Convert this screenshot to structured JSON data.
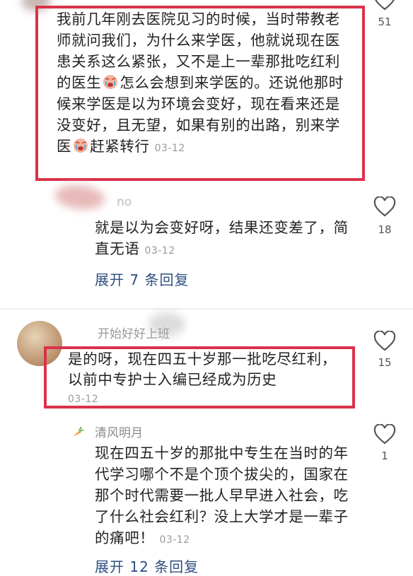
{
  "comments": {
    "main1": {
      "text_a": "我前几年刚去医院见习的时候，当时带教老师就问我们，为什么来学医，他就说现在医患关系这么紧张，又不是上一辈那批吃红利的医生",
      "text_b": "怎么会想到来学医的。还说他那时候来学医是以为环境会变好，现在看来还是没变好，且无望，如果有别的出路，别来学医",
      "text_c": "赶紧转行",
      "time": "03-12",
      "likes": "51",
      "emoji_icon": "crying-face-icon"
    },
    "reply1": {
      "username": "no",
      "text": "就是以为会变好呀，结果还变差了，简直无语",
      "time": "03-12",
      "likes": "18"
    },
    "expand1": {
      "label": "展开 7 条回复"
    },
    "main2": {
      "username": "开始好好上班",
      "text": "是的呀，现在四五十岁那一批吃尽红利，以前中专护士入编已经成为历史",
      "time": "03-12",
      "likes": "15"
    },
    "reply2": {
      "username": "清风明月",
      "text": "现在四五十岁的那批中专生在当时的年代学习哪个不是个顶个拔尖的，国家在那个时代需要一批人早早进入社会，吃了什么社会红利？没上大学才是一辈子的痛吧！",
      "time": "03-12",
      "likes": "1",
      "badge_icon": "carrot-icon"
    },
    "expand2": {
      "label": "展开 12 条回复"
    }
  },
  "colors": {
    "highlight": "#d9334a",
    "link": "#2f4f7f",
    "muted": "#9a9a9a"
  }
}
